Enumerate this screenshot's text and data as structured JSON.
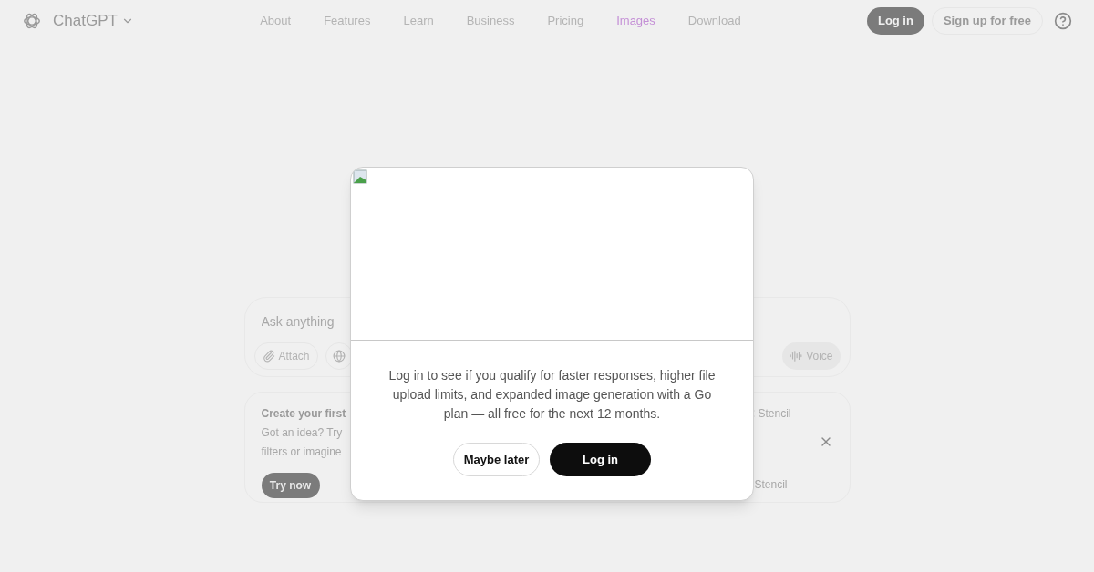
{
  "header": {
    "brand": "ChatGPT",
    "nav": [
      {
        "label": "About",
        "selected": false
      },
      {
        "label": "Features",
        "selected": false
      },
      {
        "label": "Learn",
        "selected": false
      },
      {
        "label": "Business",
        "selected": false
      },
      {
        "label": "Pricing",
        "selected": false
      },
      {
        "label": "Images",
        "selected": true
      },
      {
        "label": "Download",
        "selected": false
      }
    ],
    "login": "Log in",
    "signup": "Sign up for free"
  },
  "composer": {
    "placeholder": "Ask anything",
    "attach": "Attach",
    "voice": "Voice"
  },
  "promo": {
    "title": "Create your first",
    "lines": [
      "Got an idea? Try",
      "filters or imagine"
    ],
    "button": "Try now",
    "styles": [
      "Stencil",
      "Stencil"
    ]
  },
  "modal": {
    "image": {
      "kind": "broken-image"
    },
    "message": "Log in to see if you qualify for faster responses, higher file upload limits, and expanded image generation with a Go plan — all free for the next 12 months.",
    "secondary": "Maybe later",
    "primary": "Log in"
  }
}
